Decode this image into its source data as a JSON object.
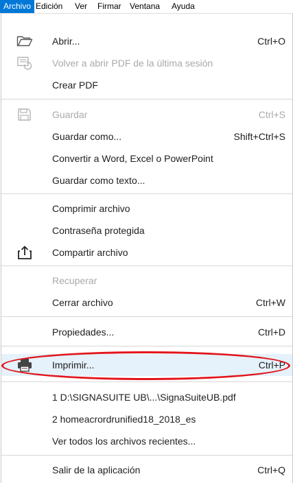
{
  "menubar": {
    "items": [
      "Archivo",
      "Edición",
      "Ver",
      "Firmar",
      "Ventana",
      "Ayuda"
    ]
  },
  "menu": {
    "open": {
      "label": "Abrir...",
      "shortcut": "Ctrl+O",
      "icon": "folder-open-icon"
    },
    "reopen": {
      "label": "Volver a abrir PDF de la última sesión",
      "icon": "reopen-icon"
    },
    "create_pdf": {
      "label": "Crear PDF"
    },
    "save": {
      "label": "Guardar",
      "shortcut": "Ctrl+S",
      "icon": "save-icon"
    },
    "save_as": {
      "label": "Guardar como...",
      "shortcut": "Shift+Ctrl+S"
    },
    "convert": {
      "label": "Convertir a Word, Excel o PowerPoint"
    },
    "save_text": {
      "label": "Guardar como texto..."
    },
    "compress": {
      "label": "Comprimir archivo"
    },
    "password": {
      "label": "Contraseña protegida"
    },
    "share": {
      "label": "Compartir archivo",
      "icon": "share-icon"
    },
    "recover": {
      "label": "Recuperar"
    },
    "close": {
      "label": "Cerrar archivo",
      "shortcut": "Ctrl+W"
    },
    "properties": {
      "label": "Propiedades...",
      "shortcut": "Ctrl+D"
    },
    "print": {
      "label": "Imprimir...",
      "shortcut": "Ctrl+P",
      "icon": "printer-icon"
    },
    "recent1": {
      "label": "1 D:\\SIGNASUITE UB\\...\\SignaSuiteUB.pdf"
    },
    "recent2": {
      "label": "2 homeacrordrunified18_2018_es"
    },
    "recent_all": {
      "label": "Ver todos los archivos recientes..."
    },
    "exit": {
      "label": "Salir de la aplicación",
      "shortcut": "Ctrl+Q"
    }
  },
  "colors": {
    "accent": "#0078d7",
    "hover": "#e5f1fb",
    "annotation": "#e2141b",
    "disabled": "#a9a9a9"
  }
}
